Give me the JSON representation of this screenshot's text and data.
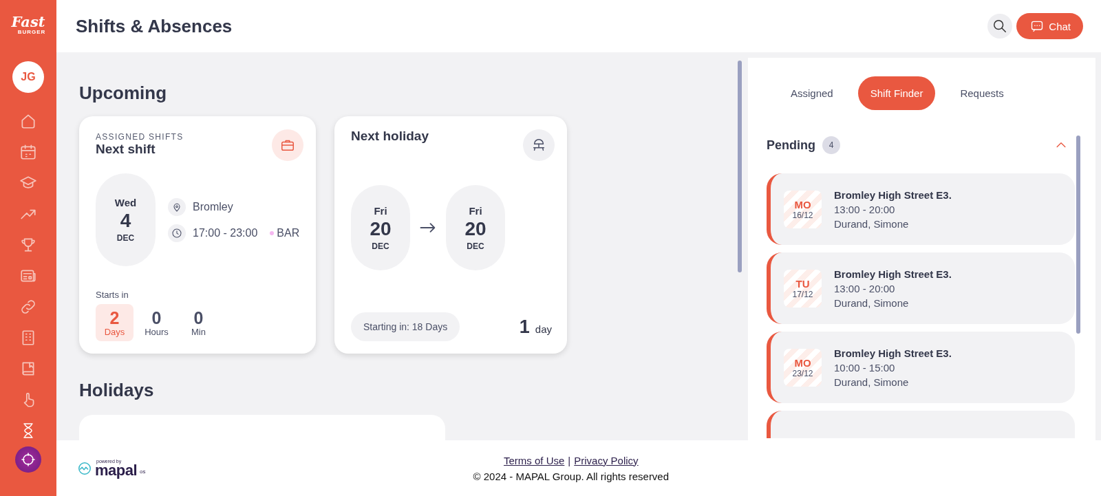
{
  "sidebar": {
    "logo": {
      "word": "Fast",
      "subword": "BURGER"
    },
    "avatar": "JG"
  },
  "header": {
    "title": "Shifts & Absences",
    "chat": "Chat"
  },
  "upcoming": {
    "heading": "Upcoming",
    "next_shift": {
      "eyebrow": "ASSIGNED SHIFTS",
      "title": "Next shift",
      "date": {
        "weekday": "Wed",
        "day": "4",
        "month": "DEC"
      },
      "location": "Bromley",
      "time": "17:00 - 23:00",
      "tag": "BAR",
      "starts_label": "Starts in",
      "countdown": [
        {
          "value": "2",
          "unit": "Days",
          "highlighted": true
        },
        {
          "value": "0",
          "unit": "Hours",
          "highlighted": false
        },
        {
          "value": "0",
          "unit": "Min",
          "highlighted": false
        }
      ]
    },
    "next_holiday": {
      "title": "Next holiday",
      "from": {
        "weekday": "Fri",
        "day": "20",
        "month": "DEC"
      },
      "to": {
        "weekday": "Fri",
        "day": "20",
        "month": "DEC"
      },
      "starting": "Starting in: 18 Days",
      "duration": "1",
      "duration_unit": "day"
    }
  },
  "holidays": {
    "heading": "Holidays"
  },
  "panel": {
    "tabs": [
      {
        "label": "Assigned",
        "selected": false
      },
      {
        "label": "Shift Finder",
        "selected": true
      },
      {
        "label": "Requests",
        "selected": false
      }
    ],
    "pending": {
      "title": "Pending",
      "count": "4",
      "expanded": true,
      "items": [
        {
          "day": "MO",
          "date": "16/12",
          "location": "Bromley High Street E3.",
          "time": "13:00 - 20:00",
          "person": "Durand, Simone"
        },
        {
          "day": "TU",
          "date": "17/12",
          "location": "Bromley High Street E3.",
          "time": "13:00 - 20:00",
          "person": "Durand, Simone"
        },
        {
          "day": "MO",
          "date": "23/12",
          "location": "Bromley High Street E3.",
          "time": "10:00 - 15:00",
          "person": "Durand, Simone"
        }
      ]
    }
  },
  "footer": {
    "powered_by": "powered by",
    "brand": "mapal",
    "brand_suffix": "os",
    "links": [
      "Terms of Use",
      "Privacy Policy"
    ],
    "separator": "|",
    "copyright": "© 2024 - MAPAL Group. All rights reserved"
  }
}
